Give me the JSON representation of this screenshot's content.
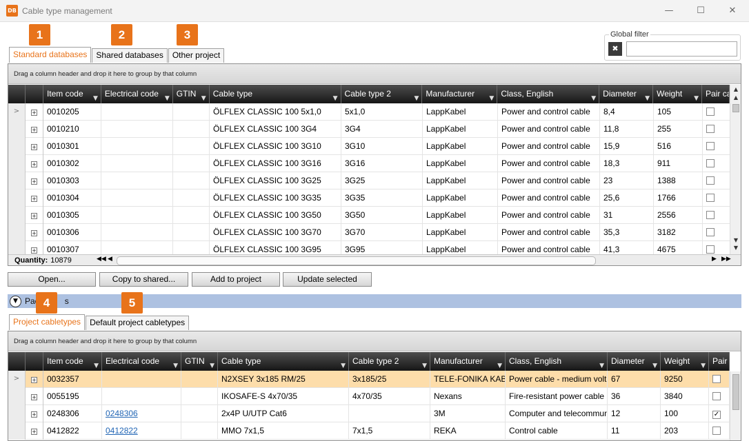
{
  "window": {
    "title": "Cable type management",
    "app_icon_text": "DB",
    "minimize": "—",
    "maximize": "☐",
    "close": "✕"
  },
  "badges": [
    "1",
    "2",
    "3",
    "4",
    "5"
  ],
  "top_tabs": [
    "Standard databases",
    "Shared databases",
    "Other project"
  ],
  "global_filter": {
    "label": "Global filter",
    "value": ""
  },
  "group_hint": "Drag a column header and drop it here to group by that column",
  "top_grid": {
    "columns": [
      "Item code",
      "Electrical code",
      "GTIN",
      "Cable type",
      "Cable type 2",
      "Manufacturer",
      "Class, English",
      "Diameter",
      "Weight",
      "Pair cable"
    ],
    "rows": [
      [
        "0010205",
        "",
        "",
        "ÖLFLEX CLASSIC 100 5x1,0",
        "5x1,0",
        "LappKabel",
        "Power and control cable",
        "8,4",
        "105"
      ],
      [
        "0010210",
        "",
        "",
        "ÖLFLEX CLASSIC 100 3G4",
        "3G4",
        "LappKabel",
        "Power and control cable",
        "11,8",
        "255"
      ],
      [
        "0010301",
        "",
        "",
        "ÖLFLEX CLASSIC 100 3G10",
        "3G10",
        "LappKabel",
        "Power and control cable",
        "15,9",
        "516"
      ],
      [
        "0010302",
        "",
        "",
        "ÖLFLEX CLASSIC 100 3G16",
        "3G16",
        "LappKabel",
        "Power and control cable",
        "18,3",
        "911"
      ],
      [
        "0010303",
        "",
        "",
        "ÖLFLEX CLASSIC 100 3G25",
        "3G25",
        "LappKabel",
        "Power and control cable",
        "23",
        "1388"
      ],
      [
        "0010304",
        "",
        "",
        "ÖLFLEX CLASSIC 100 3G35",
        "3G35",
        "LappKabel",
        "Power and control cable",
        "25,6",
        "1766"
      ],
      [
        "0010305",
        "",
        "",
        "ÖLFLEX CLASSIC 100 3G50",
        "3G50",
        "LappKabel",
        "Power and control cable",
        "31",
        "2556"
      ],
      [
        "0010306",
        "",
        "",
        "ÖLFLEX CLASSIC 100 3G70",
        "3G70",
        "LappKabel",
        "Power and control cable",
        "35,3",
        "3182"
      ],
      [
        "0010307",
        "",
        "",
        "ÖLFLEX CLASSIC 100 3G95",
        "3G95",
        "LappKabel",
        "Power and control cable",
        "41,3",
        "4675"
      ]
    ],
    "quantity_label": "Quantity:",
    "quantity_value": "10879"
  },
  "actions": [
    "Open...",
    "Copy to shared...",
    "Add to project",
    "Update selected"
  ],
  "panel": {
    "label": "Pac",
    "label_tail": "s"
  },
  "bottom_tabs": [
    "Project cabletypes",
    "Default project cabletypes"
  ],
  "bottom_grid": {
    "columns": [
      "Item code",
      "Electrical code",
      "GTIN",
      "Cable type",
      "Cable type 2",
      "Manufacturer",
      "Class, English",
      "Diameter",
      "Weight",
      "Pair cable"
    ],
    "rows": [
      [
        "0032357",
        "",
        "",
        "N2XSEY 3x185 RM/25",
        "3x185/25",
        "TELE-FONIKA KABLE",
        "Power cable - medium voltage",
        "67",
        "9250",
        false
      ],
      [
        "0055195",
        "",
        "",
        "IKOSAFE-S 4x70/35",
        "4x70/35",
        "Nexans",
        "Fire-resistant power cable",
        "36",
        "3840",
        false
      ],
      [
        "0248306",
        "0248306",
        "",
        "2x4P U/UTP Cat6",
        "",
        "3M",
        "Computer and telecommunication cable",
        "12",
        "100",
        true
      ],
      [
        "0412822",
        "0412822",
        "",
        "MMO 7x1,5",
        "7x1,5",
        "REKA",
        "Control cable",
        "11",
        "203",
        false
      ]
    ]
  },
  "icons": {
    "row_pointer": "chevron-right-icon",
    "expand": "plus-box-icon",
    "filter": "funnel-icon",
    "clear_filter": "clear-filter-icon",
    "panel_toggle": "chevron-down-icon"
  }
}
